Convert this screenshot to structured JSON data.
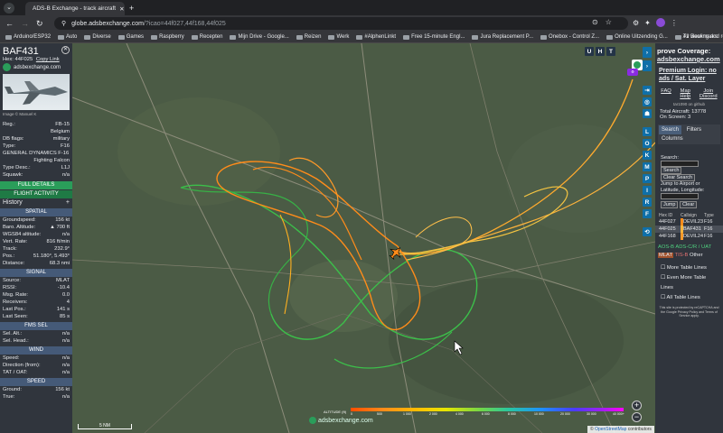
{
  "browser": {
    "tab_title": "ADS-B Exchange - track aircraft",
    "url_host": "globe.adsbexchange.com",
    "url_rest": "/?icao=44f027,44f168,44f025",
    "bookmarks": [
      "Arduino/ESP32",
      "Auto",
      "Diverse",
      "Games",
      "Raspberry",
      "Recepten",
      "Mijn Drive - Google...",
      "Reizen",
      "Werk",
      "#AlphenLinkt",
      "Free 15-minute Engl...",
      "Jura Replacement P...",
      "Onebox - Control Z...",
      "Online Uitzending G...",
      "Tv viewing and reco..."
    ],
    "all_bookmarks": "All Bookmarks"
  },
  "aircraft": {
    "callsign": "BAF431",
    "hex_label": "Hex:",
    "hex": "44F025",
    "copy_link": "Copy Link",
    "site": "adsbexchange.com",
    "image_credit": "Image © Manuel K",
    "fields": [
      {
        "k": "Reg.:",
        "v": "FB-15"
      },
      {
        "k": "",
        "v": "Belgium"
      },
      {
        "k": "DB flags:",
        "v": "military"
      },
      {
        "k": "Type:",
        "v": "F16"
      },
      {
        "k": "GENERAL DYNAMICS F-16",
        "v": ""
      },
      {
        "k": "",
        "v": "Fighting Falcon"
      },
      {
        "k": "Type Desc.:",
        "v": "L1J"
      },
      {
        "k": "Squawk:",
        "v": "n/a"
      }
    ],
    "full_details": "FULL DETAILS",
    "flight_activity": "FLIGHT ACTIVITY",
    "history": "History",
    "spatial_title": "SPATIAL",
    "spatial": [
      {
        "k": "Groundspeed:",
        "v": "156 kt"
      },
      {
        "k": "Baro. Altitude:",
        "v": "▲ 700 ft"
      },
      {
        "k": "WGS84 altitude:",
        "v": "n/a"
      },
      {
        "k": "Vert. Rate:",
        "v": "816 ft/min"
      },
      {
        "k": "Track:",
        "v": "232.9°"
      },
      {
        "k": "Pos.:",
        "v": "51.180°, 5.493°"
      },
      {
        "k": "Distance:",
        "v": "68.3 nmi"
      }
    ],
    "signal_title": "SIGNAL",
    "signal": [
      {
        "k": "Source:",
        "v": "MLAT"
      },
      {
        "k": "RSSI:",
        "v": "-10.4"
      },
      {
        "k": "Msg. Rate:",
        "v": "0.0"
      },
      {
        "k": "Receivers:",
        "v": "4"
      },
      {
        "k": "Last Pos.:",
        "v": "141 s"
      },
      {
        "k": "Last Seen:",
        "v": "85 s"
      }
    ],
    "fms_title": "FMS SEL",
    "fms": [
      {
        "k": "Sel. Alt.:",
        "v": "n/a"
      },
      {
        "k": "Sel. Head.:",
        "v": "n/a"
      }
    ],
    "wind_title": "WIND",
    "wind": [
      {
        "k": "Speed:",
        "v": "n/a"
      },
      {
        "k": "Direction (from):",
        "v": "n/a"
      },
      {
        "k": "TAT / OAT:",
        "v": "n/a"
      }
    ],
    "speed_title": "SPEED",
    "speed": [
      {
        "k": "Ground:",
        "v": "156 kt"
      },
      {
        "k": "True:",
        "v": "n/a"
      }
    ]
  },
  "map": {
    "top_buttons": [
      "U",
      "H",
      "T"
    ],
    "side_buttons": [
      "L",
      "O",
      "K",
      "M",
      "P",
      "I",
      "R",
      "F"
    ],
    "scale_label": "5 NM",
    "watermark": "adsbexchange.com",
    "altitude_label": "ALTITUDE (ft)",
    "alt_ticks": [
      "0",
      "500",
      "1 000",
      "2 000",
      "4 000",
      "6 000",
      "8 000",
      "10 000",
      "20 000",
      "30 000",
      "40 000+"
    ],
    "attribution_link": "OpenStreetMap",
    "attribution_suffix": "contributors",
    "attribution_prefix": "©"
  },
  "right": {
    "improve": "prove Coverage:",
    "site_link": "adsbexchange.com",
    "premium": "Premium Login: no ads / Sat. Layer",
    "faq": "FAQ",
    "map_help": "Map Help",
    "join_discord": "Join Discord",
    "tar": "tar1090 on github",
    "total_label": "Total Aircraft:",
    "total": "13778",
    "onscreen_label": "On Screen:",
    "onscreen": "3",
    "tabs": [
      "Search",
      "Filters",
      "Columns"
    ],
    "search_label": "Search:",
    "search_btn": "Search",
    "clear_search": "Clear Search",
    "jump_label": "Jump to Airport or Latitude, Longitude:",
    "jump_btn": "Jump",
    "clear_btn": "Clear",
    "table_headers": [
      "Hex ID",
      "Callsign",
      "Type"
    ],
    "table_rows": [
      {
        "hex": "44F027",
        "callsign": "DEVIL23",
        "type": "F16"
      },
      {
        "hex": "44F025",
        "callsign": "BAF431",
        "type": "F16"
      },
      {
        "hex": "44F168",
        "callsign": "DEVIL24",
        "type": "F16"
      }
    ],
    "filters": [
      "AOS-B",
      "ADS-C/R / UAT",
      "MLAT",
      "TIS-B",
      "Other"
    ],
    "more_lines": "More Table Lines",
    "even_more": "Even More Table Lines",
    "all_lines": "All Table Lines",
    "recaptcha": "This site is protected by reCAPTCHA and the Google Privacy Policy and Terms of Service apply."
  },
  "colors": {
    "map_bg": "#4a5a44",
    "panel": "#30353d",
    "accent_green": "#2a9d5a",
    "track_orange": "#ff8c1a",
    "track_green": "#3cbf4a",
    "toolbar_blue": "#0f6fa8"
  }
}
